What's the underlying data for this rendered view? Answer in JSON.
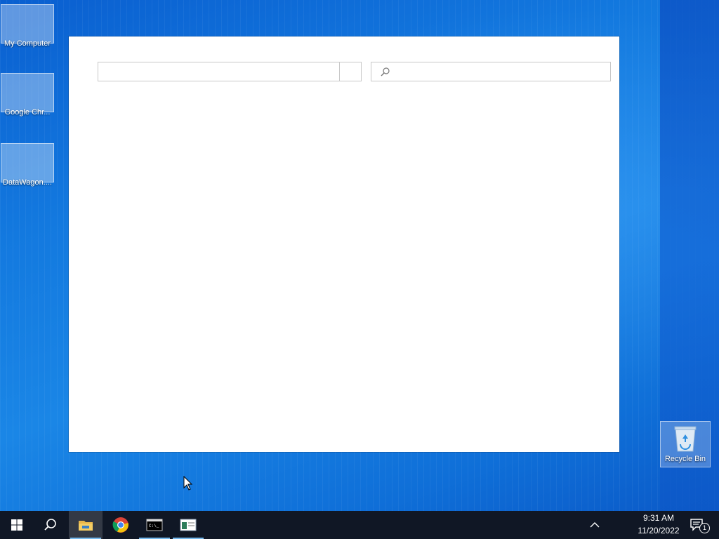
{
  "desktop": {
    "icons": [
      {
        "label": "My Computer",
        "icon": "computer-icon"
      },
      {
        "label": "Google Chr...",
        "icon": "chrome-icon"
      },
      {
        "label": "DataWagon....",
        "icon": "shortcut-icon"
      }
    ],
    "recycle_bin": {
      "label": "Recycle Bin",
      "icon": "recycle-bin-icon"
    }
  },
  "window": {
    "path_field": {
      "value": "",
      "placeholder": ""
    },
    "search_field": {
      "value": "",
      "placeholder": ""
    }
  },
  "taskbar": {
    "buttons": [
      {
        "name": "start",
        "icon": "windows-logo-icon"
      },
      {
        "name": "search",
        "icon": "search-icon"
      },
      {
        "name": "file-explorer",
        "icon": "folder-icon",
        "active": true
      },
      {
        "name": "chrome",
        "icon": "chrome-icon"
      },
      {
        "name": "command-prompt",
        "icon": "terminal-icon"
      },
      {
        "name": "app-window",
        "icon": "window-icon"
      }
    ],
    "clock": {
      "time": "9:31 AM",
      "date": "11/20/2022"
    },
    "notifications": {
      "count": "1"
    }
  },
  "colors": {
    "taskbar": "#101725",
    "desktop": "#1379df",
    "active_underline": "#76b9ed"
  }
}
